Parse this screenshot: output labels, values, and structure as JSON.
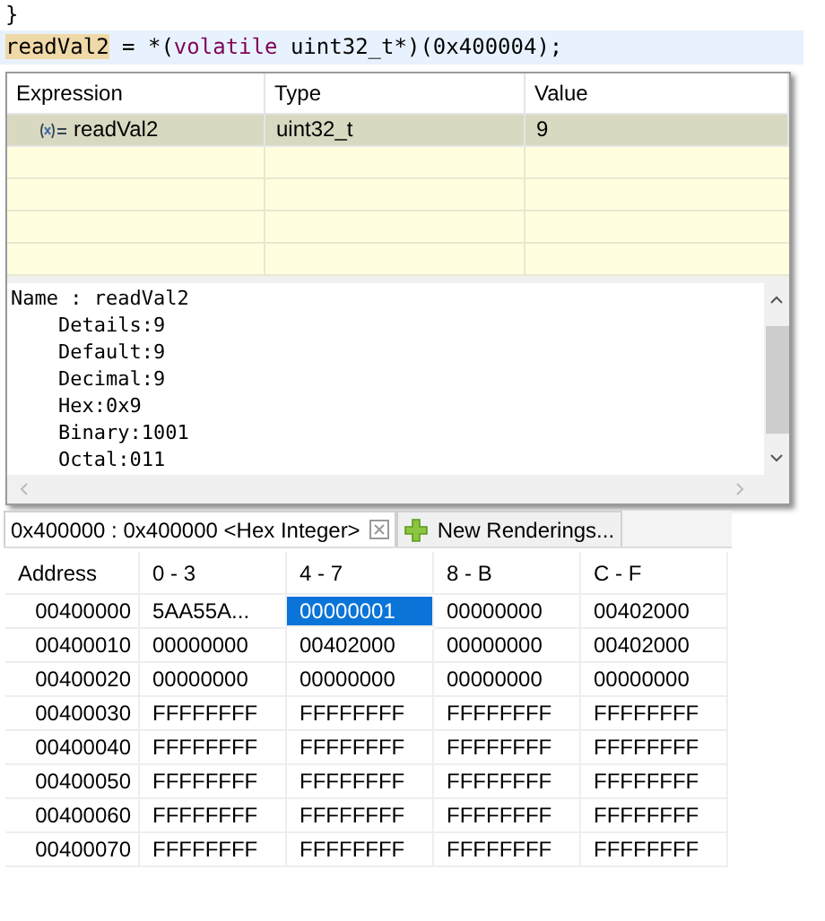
{
  "editor": {
    "lines": [
      {
        "highlighted": false,
        "tokens": [
          {
            "kind": "plain",
            "text": "}"
          }
        ]
      },
      {
        "highlighted": true,
        "tokens": [
          {
            "kind": "occurrence",
            "text": "readVal2"
          },
          {
            "kind": "plain",
            "text": " = *("
          },
          {
            "kind": "keyword",
            "text": "volatile"
          },
          {
            "kind": "plain",
            "text": " uint32_t*)(0x400004);"
          }
        ]
      }
    ]
  },
  "expressions": {
    "columns": [
      "Expression",
      "Type",
      "Value"
    ],
    "rows": [
      {
        "expression": "readVal2",
        "type": "uint32_t",
        "value": "9",
        "selected": true
      }
    ],
    "details": [
      "Name : readVal2",
      "    Details:9",
      "    Default:9",
      "    Decimal:9",
      "    Hex:0x9",
      "    Binary:1001",
      "    Octal:011"
    ]
  },
  "memory": {
    "tabs": [
      {
        "label": "0x400000 : 0x400000 <Hex Integer>",
        "kind": "rendering",
        "selected": true
      },
      {
        "label": "New Renderings...",
        "kind": "add",
        "selected": false
      }
    ],
    "address_header": "Address",
    "columns": [
      "0 - 3",
      "4 - 7",
      "8 - B",
      "C - F"
    ],
    "rows": [
      {
        "address": "00400000",
        "cells": [
          {
            "text": "5AA55A...",
            "selected": false
          },
          {
            "text": "00000001",
            "selected": true
          },
          {
            "text": "00000000",
            "selected": false
          },
          {
            "text": "00402000",
            "selected": false
          }
        ]
      },
      {
        "address": "00400010",
        "cells": [
          {
            "text": "00000000",
            "selected": false
          },
          {
            "text": "00402000",
            "selected": false
          },
          {
            "text": "00000000",
            "selected": false
          },
          {
            "text": "00402000",
            "selected": false
          }
        ]
      },
      {
        "address": "00400020",
        "cells": [
          {
            "text": "00000000",
            "selected": false
          },
          {
            "text": "00000000",
            "selected": false
          },
          {
            "text": "00000000",
            "selected": false
          },
          {
            "text": "00000000",
            "selected": false
          }
        ]
      },
      {
        "address": "00400030",
        "cells": [
          {
            "text": "FFFFFFFF",
            "selected": false
          },
          {
            "text": "FFFFFFFF",
            "selected": false
          },
          {
            "text": "FFFFFFFF",
            "selected": false
          },
          {
            "text": "FFFFFFFF",
            "selected": false
          }
        ]
      },
      {
        "address": "00400040",
        "cells": [
          {
            "text": "FFFFFFFF",
            "selected": false
          },
          {
            "text": "FFFFFFFF",
            "selected": false
          },
          {
            "text": "FFFFFFFF",
            "selected": false
          },
          {
            "text": "FFFFFFFF",
            "selected": false
          }
        ]
      },
      {
        "address": "00400050",
        "cells": [
          {
            "text": "FFFFFFFF",
            "selected": false
          },
          {
            "text": "FFFFFFFF",
            "selected": false
          },
          {
            "text": "FFFFFFFF",
            "selected": false
          },
          {
            "text": "FFFFFFFF",
            "selected": false
          }
        ]
      },
      {
        "address": "00400060",
        "cells": [
          {
            "text": "FFFFFFFF",
            "selected": false
          },
          {
            "text": "FFFFFFFF",
            "selected": false
          },
          {
            "text": "FFFFFFFF",
            "selected": false
          },
          {
            "text": "FFFFFFFF",
            "selected": false
          }
        ]
      },
      {
        "address": "00400070",
        "cells": [
          {
            "text": "FFFFFFFF",
            "selected": false
          },
          {
            "text": "FFFFFFFF",
            "selected": false
          },
          {
            "text": "FFFFFFFF",
            "selected": false
          },
          {
            "text": "FFFFFFFF",
            "selected": false
          }
        ]
      }
    ]
  }
}
